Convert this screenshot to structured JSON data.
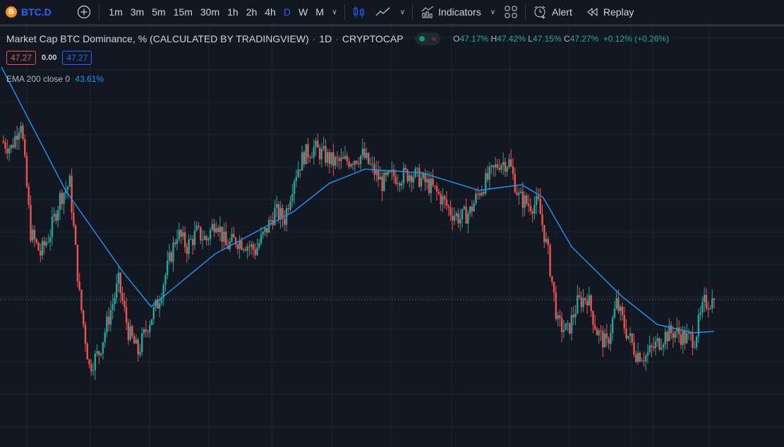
{
  "toolbar": {
    "symbol": "BTC.D",
    "symbol_icon": "B",
    "intervals": [
      "1m",
      "3m",
      "5m",
      "15m",
      "30m",
      "1h",
      "2h",
      "4h",
      "D",
      "W",
      "M"
    ],
    "active_interval": "D",
    "indicators_label": "Indicators",
    "alert_label": "Alert",
    "replay_label": "Replay"
  },
  "legend": {
    "title": "Market Cap BTC Dominance, % (CALCULATED BY TRADINGVIEW)",
    "sep1": "·",
    "timeframe": "1D",
    "sep2": "·",
    "exchange": "CRYPTOCAP",
    "o_label": "O",
    "o": "47.17%",
    "h_label": "H",
    "h": "47.42%",
    "l_label": "L",
    "l": "47.15%",
    "c_label": "C",
    "c": "47.27%",
    "change": "+0.12% (+0.26%)",
    "bid": "47.27",
    "spread": "0.00",
    "ask": "47.27",
    "ema_label": "EMA 200 close 0",
    "ema_value": "43.61%"
  },
  "colors": {
    "up": "#26a69a",
    "down": "#ef5350",
    "ema": "#2196f3",
    "bg": "#131722",
    "grid": "#1f2330",
    "accent": "#2962ff"
  },
  "chart_data": {
    "type": "candlestick",
    "title": "Market Cap BTC Dominance, %",
    "ylim": [
      30.28,
      78.73
    ],
    "last_price": 47.27,
    "closes": [
      65.56,
      64.75,
      68.0,
      54.99,
      52.55,
      54.99,
      59.06,
      60.68,
      47.68,
      39.55,
      41.17,
      45.24,
      49.3,
      43.61,
      41.17,
      44.42,
      46.86,
      50.93,
      54.99,
      53.37,
      54.99,
      54.18,
      56.62,
      53.37,
      54.18,
      53.77,
      52.96,
      54.99,
      57.43,
      56.62,
      61.5,
      63.94,
      64.75,
      63.94,
      63.12,
      63.12,
      63.53,
      63.94,
      62.31,
      60.68,
      61.5,
      61.5,
      61.9,
      61.09,
      60.28,
      59.06,
      57.43,
      56.62,
      57.43,
      59.87,
      61.5,
      63.12,
      63.12,
      59.06,
      58.25,
      58.25,
      52.55,
      44.42,
      43.61,
      46.86,
      47.68,
      43.61,
      41.99,
      46.86,
      43.61,
      41.17,
      40.77,
      41.99,
      43.2,
      43.61,
      42.8,
      42.8,
      46.86,
      47.27
    ],
    "ema200": {
      "x_fraction": [
        0,
        0.09,
        0.17,
        0.21,
        0.3,
        0.41,
        0.46,
        0.51,
        0.59,
        0.67,
        0.73,
        0.76,
        0.8,
        0.87,
        0.92,
        0.97,
        1.0
      ],
      "values": [
        74.1,
        59.87,
        50.52,
        46.46,
        52.55,
        57.43,
        60.68,
        62.31,
        61.9,
        59.87,
        60.52,
        59.06,
        53.37,
        47.68,
        44.42,
        43.45,
        43.61
      ]
    }
  }
}
